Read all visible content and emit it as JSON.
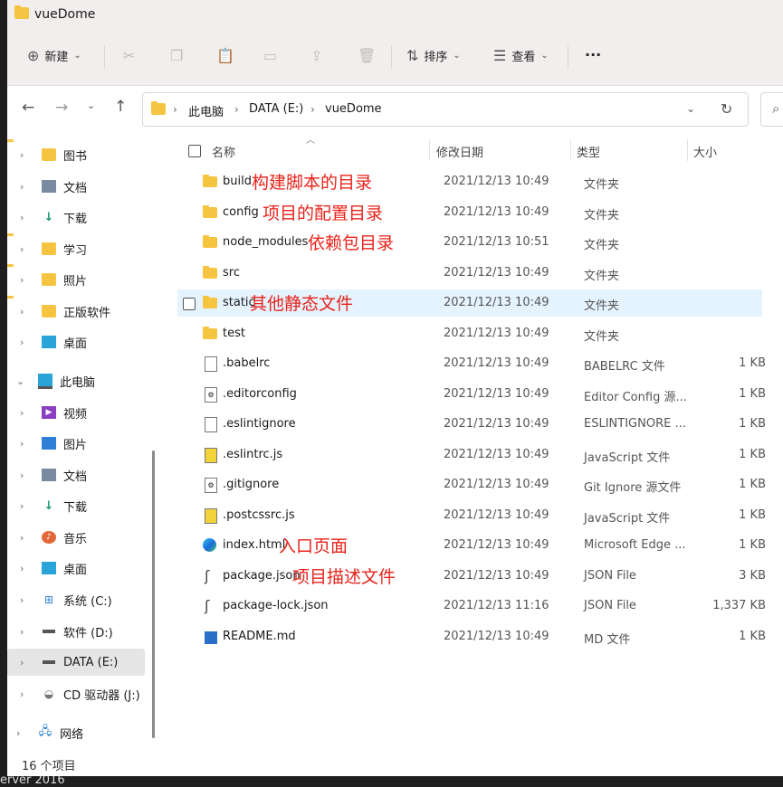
{
  "window": {
    "title": "vueDome"
  },
  "toolbar": {
    "new_label": "新建",
    "sort_label": "排序",
    "view_label": "查看",
    "more_label": "···"
  },
  "address": {
    "crumbs": [
      "此电脑",
      "DATA (E:)",
      "vueDome"
    ]
  },
  "sidebar": {
    "items": [
      {
        "label": "图书",
        "icon": "folder-icon"
      },
      {
        "label": "文档",
        "icon": "document-icon"
      },
      {
        "label": "下载",
        "icon": "download-icon"
      },
      {
        "label": "学习",
        "icon": "folder-icon"
      },
      {
        "label": "照片",
        "icon": "folder-icon"
      },
      {
        "label": "正版软件",
        "icon": "folder-icon"
      },
      {
        "label": "桌面",
        "icon": "desktop-icon"
      },
      {
        "label": "此电脑",
        "icon": "computer-icon"
      },
      {
        "label": "视频",
        "icon": "video-icon"
      },
      {
        "label": "图片",
        "icon": "picture-icon"
      },
      {
        "label": "文档",
        "icon": "document-icon"
      },
      {
        "label": "下载",
        "icon": "download-icon"
      },
      {
        "label": "音乐",
        "icon": "music-icon"
      },
      {
        "label": "桌面",
        "icon": "desktop-icon"
      },
      {
        "label": "系统 (C:)",
        "icon": "windows-drive-icon"
      },
      {
        "label": "软件 (D:)",
        "icon": "drive-icon"
      },
      {
        "label": "DATA (E:)",
        "icon": "drive-icon"
      },
      {
        "label": "CD 驱动器 (J:)",
        "icon": "cd-drive-icon"
      },
      {
        "label": "网络",
        "icon": "network-icon"
      }
    ]
  },
  "columns": {
    "name": "名称",
    "date": "修改日期",
    "type": "类型",
    "size": "大小"
  },
  "files": [
    {
      "name": "build",
      "date": "2021/12/13 10:49",
      "type": "文件夹",
      "size": "",
      "icon": "folder-icon",
      "note": "构建脚本的目录"
    },
    {
      "name": "config",
      "date": "2021/12/13 10:49",
      "type": "文件夹",
      "size": "",
      "icon": "folder-icon",
      "note": "项目的配置目录"
    },
    {
      "name": "node_modules",
      "date": "2021/12/13 10:51",
      "type": "文件夹",
      "size": "",
      "icon": "folder-icon",
      "note": "依赖包目录"
    },
    {
      "name": "src",
      "date": "2021/12/13 10:49",
      "type": "文件夹",
      "size": "",
      "icon": "folder-icon",
      "note": ""
    },
    {
      "name": "static",
      "date": "2021/12/13 10:49",
      "type": "文件夹",
      "size": "",
      "icon": "folder-icon",
      "note": "其他静态文件"
    },
    {
      "name": "test",
      "date": "2021/12/13 10:49",
      "type": "文件夹",
      "size": "",
      "icon": "folder-icon",
      "note": ""
    },
    {
      "name": ".babelrc",
      "date": "2021/12/13 10:49",
      "type": "BABELRC 文件",
      "size": "1 KB",
      "icon": "file-icon",
      "note": ""
    },
    {
      "name": ".editorconfig",
      "date": "2021/12/13 10:49",
      "type": "Editor Config 源...",
      "size": "1 KB",
      "icon": "config-file-icon",
      "note": ""
    },
    {
      "name": ".eslintignore",
      "date": "2021/12/13 10:49",
      "type": "ESLINTIGNORE ...",
      "size": "1 KB",
      "icon": "file-icon",
      "note": ""
    },
    {
      "name": ".eslintrc.js",
      "date": "2021/12/13 10:49",
      "type": "JavaScript 文件",
      "size": "1 KB",
      "icon": "js-file-icon",
      "note": ""
    },
    {
      "name": ".gitignore",
      "date": "2021/12/13 10:49",
      "type": "Git Ignore 源文件",
      "size": "1 KB",
      "icon": "config-file-icon",
      "note": ""
    },
    {
      "name": ".postcssrc.js",
      "date": "2021/12/13 10:49",
      "type": "JavaScript 文件",
      "size": "1 KB",
      "icon": "js-file-icon",
      "note": ""
    },
    {
      "name": "index.html",
      "date": "2021/12/13 10:49",
      "type": "Microsoft Edge ...",
      "size": "1 KB",
      "icon": "edge-icon",
      "note": "入口页面"
    },
    {
      "name": "package.json",
      "date": "2021/12/13 10:49",
      "type": "JSON File",
      "size": "3 KB",
      "icon": "json-file-icon",
      "note": "项目描述文件"
    },
    {
      "name": "package-lock.json",
      "date": "2021/12/13 11:16",
      "type": "JSON File",
      "size": "1,337 KB",
      "icon": "json-file-icon",
      "note": ""
    },
    {
      "name": "README.md",
      "date": "2021/12/13 10:49",
      "type": "MD 文件",
      "size": "1 KB",
      "icon": "markdown-file-icon",
      "note": ""
    }
  ],
  "status": {
    "count_text": "16 个项目"
  },
  "background": {
    "taskbar_fragment": "erver 2016"
  }
}
